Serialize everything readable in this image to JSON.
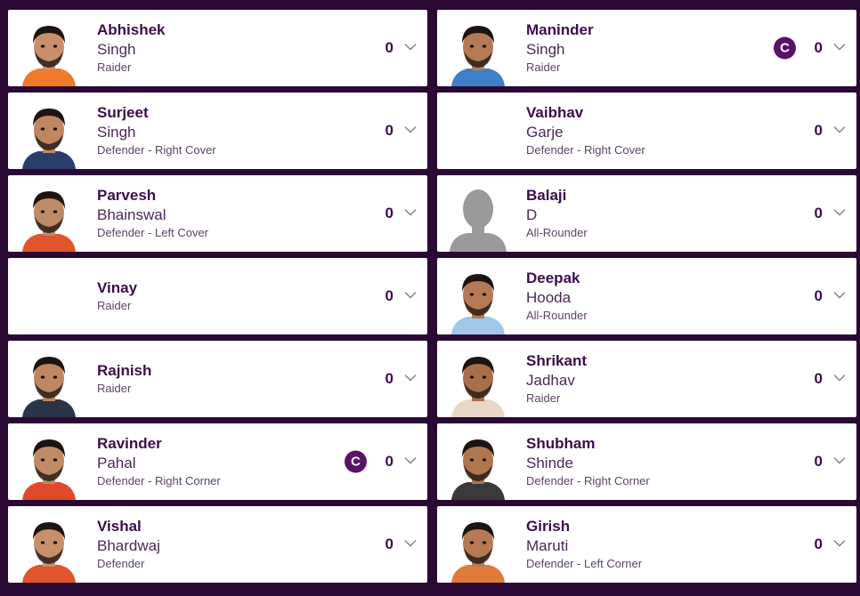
{
  "colors": {
    "background": "#2a0a35",
    "card": "#ffffff",
    "accent": "#5a1168",
    "text_primary": "#3b0e4a"
  },
  "players": [
    {
      "first": "Abhishek",
      "last": "Singh",
      "role": "Raider",
      "score": "0",
      "captain": false,
      "photo": "player-photo",
      "jersey": "#f07a2a"
    },
    {
      "first": "Maninder",
      "last": "Singh",
      "role": "Raider",
      "score": "0",
      "captain": true,
      "captain_label": "C",
      "photo": "player-photo",
      "jersey": "#3e7fc7"
    },
    {
      "first": "Surjeet",
      "last": "Singh",
      "role": "Defender - Right Cover",
      "score": "0",
      "captain": false,
      "photo": "player-photo",
      "jersey": "#2b3e6b"
    },
    {
      "first": "Vaibhav",
      "last": "Garje",
      "role": "Defender - Right Cover",
      "score": "0",
      "captain": false,
      "photo": "none"
    },
    {
      "first": "Parvesh",
      "last": "Bhainswal",
      "role": "Defender - Left Cover",
      "score": "0",
      "captain": false,
      "photo": "player-photo",
      "jersey": "#e0552b"
    },
    {
      "first": "Balaji",
      "last": "D",
      "role": "All-Rounder",
      "score": "0",
      "captain": false,
      "photo": "placeholder-silhouette"
    },
    {
      "first": "Vinay",
      "last": "",
      "role": "Raider",
      "score": "0",
      "captain": false,
      "photo": "none"
    },
    {
      "first": "Deepak",
      "last": "Hooda",
      "role": "All-Rounder",
      "score": "0",
      "captain": false,
      "photo": "player-photo",
      "jersey": "#9fc7e6"
    },
    {
      "first": "Rajnish",
      "last": "",
      "role": "Raider",
      "score": "0",
      "captain": false,
      "photo": "player-photo",
      "jersey": "#2b3548"
    },
    {
      "first": "Shrikant",
      "last": "Jadhav",
      "role": "Raider",
      "score": "0",
      "captain": false,
      "photo": "player-photo",
      "jersey": "#e8d7c5"
    },
    {
      "first": "Ravinder",
      "last": "Pahal",
      "role": "Defender - Right Corner",
      "score": "0",
      "captain": true,
      "captain_label": "C",
      "photo": "player-photo",
      "jersey": "#e04a2a"
    },
    {
      "first": "Shubham",
      "last": "Shinde",
      "role": "Defender - Right Corner",
      "score": "0",
      "captain": false,
      "photo": "player-photo",
      "jersey": "#3a3a3a"
    },
    {
      "first": "Vishal",
      "last": "Bhardwaj",
      "role": "Defender",
      "score": "0",
      "captain": false,
      "photo": "player-photo",
      "jersey": "#e0552b"
    },
    {
      "first": "Girish",
      "last": "Maruti",
      "role": "Defender - Left Corner",
      "score": "0",
      "captain": false,
      "photo": "player-photo",
      "jersey": "#e07a3a"
    }
  ]
}
